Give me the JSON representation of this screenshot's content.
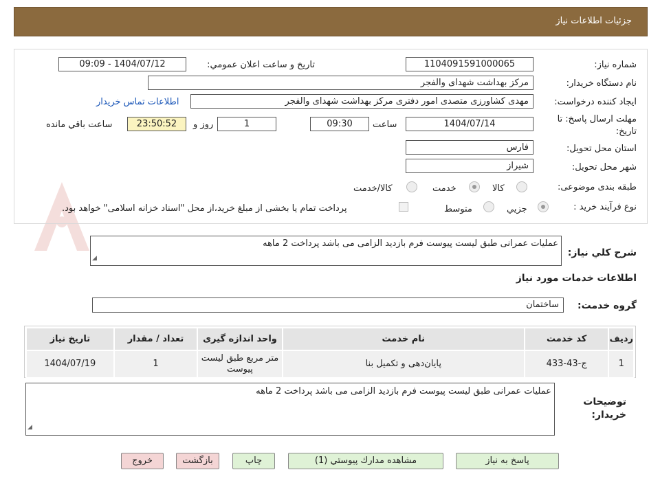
{
  "header": {
    "title": "جزئیات اطلاعات نیاز"
  },
  "fields": {
    "need_number_label": "شماره نیاز:",
    "need_number": "1104091591000065",
    "announce_label": "تاریخ و ساعت اعلان عمومي:",
    "announce_value": "1404/07/12 - 09:09",
    "buyer_org_label": "نام دستگاه خريدار:",
    "buyer_org": "مرکز بهداشت شهدای والفجر",
    "creator_label": "ایجاد کننده درخواست:",
    "creator": "مهدی کشاورزی متصدی امور دفتری مرکز بهداشت شهدای والفجر",
    "contact_link": "اطلاعات تماس خریدار",
    "deadline_label_1": "مهلت ارسال پاسخ: تا",
    "deadline_label_2": "تاریخ:",
    "deadline_date": "1404/07/14",
    "time_label": "ساعت",
    "deadline_time": "09:30",
    "days_value": "1",
    "days_label": "روز و",
    "remaining_time": "23:50:52",
    "remaining_label": "ساعت باقي مانده",
    "province_label": "استان محل تحویل:",
    "province": "فارس",
    "city_label": "شهر محل تحویل:",
    "city": "شیراز",
    "category_label": "طبقه بندی موضوعی:",
    "category_options": [
      "کالا",
      "خدمت",
      "کالا/خدمت"
    ],
    "purchase_type_label": "نوع فرآیند خرید :",
    "purchase_type_options": [
      "جزیي",
      "متوسط"
    ],
    "payment_note": "پرداخت تمام یا بخشی از مبلغ خرید،از محل \"اسناد خزانه اسلامی\" خواهد بود."
  },
  "summary": {
    "label": "شرح کلي نياز:",
    "text": "عملیات عمرانی طبق لیست پیوست فرم بازدید الزامی می باشد پرداخت 2 ماهه"
  },
  "services_section": {
    "title": "اطلاعات خدمات مورد نیاز",
    "group_label": "گروه خدمت:",
    "group_value": "ساختمان"
  },
  "table": {
    "headers": [
      "ردیف",
      "کد خدمت",
      "نام خدمت",
      "واحد اندازه گیری",
      "تعداد / مقدار",
      "تاریخ نیاز"
    ],
    "rows": [
      [
        "1",
        "ج-43-433",
        "پایان‌دهی و تکمیل بنا",
        "متر مربع طبق لیست پیوست",
        "1",
        "1404/07/19"
      ]
    ]
  },
  "buyer_notes": {
    "label_1": "توضیحات",
    "label_2": "خریدار:",
    "text": "عملیات عمرانی طبق لیست پیوست فرم بازدید الزامی می باشد پرداخت 2 ماهه"
  },
  "buttons": {
    "respond": "پاسخ به نیاز",
    "attachments": "مشاهده مدارك پيوستي (1)",
    "print": "چاپ",
    "back": "بازگشت",
    "exit": "خروج"
  },
  "watermark": {
    "text": "AriaTender.neT"
  },
  "colors": {
    "header_bg": "#8b6a3e",
    "button_green": "#dff2d6",
    "button_red": "#f4d5d5",
    "link": "#1a56b8"
  }
}
